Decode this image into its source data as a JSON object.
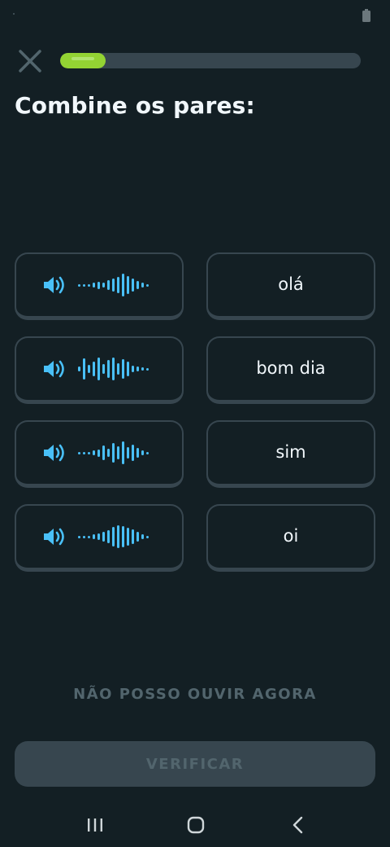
{
  "header": {
    "close_icon": "close-icon",
    "progress": 0.15
  },
  "title": "Combine os pares:",
  "pairs": {
    "audio_items": [
      {
        "icon": "speaker-icon",
        "waveform": "waveform-1"
      },
      {
        "icon": "speaker-icon",
        "waveform": "waveform-2"
      },
      {
        "icon": "speaker-icon",
        "waveform": "waveform-3"
      },
      {
        "icon": "speaker-icon",
        "waveform": "waveform-4"
      }
    ],
    "words": [
      "olá",
      "bom dia",
      "sim",
      "oi"
    ]
  },
  "actions": {
    "cant_listen": "NÃO POSSO OUVIR AGORA",
    "verify": "VERIFICAR"
  },
  "navigation": {
    "recents_icon": "recents-icon",
    "home_icon": "home-icon",
    "back_icon": "back-icon"
  },
  "colors": {
    "background": "#131f24",
    "progress_fill": "#93d333",
    "progress_track": "#37464f",
    "audio_accent": "#49c0f8",
    "card_border": "#37464f",
    "disabled_text": "#52656d"
  }
}
